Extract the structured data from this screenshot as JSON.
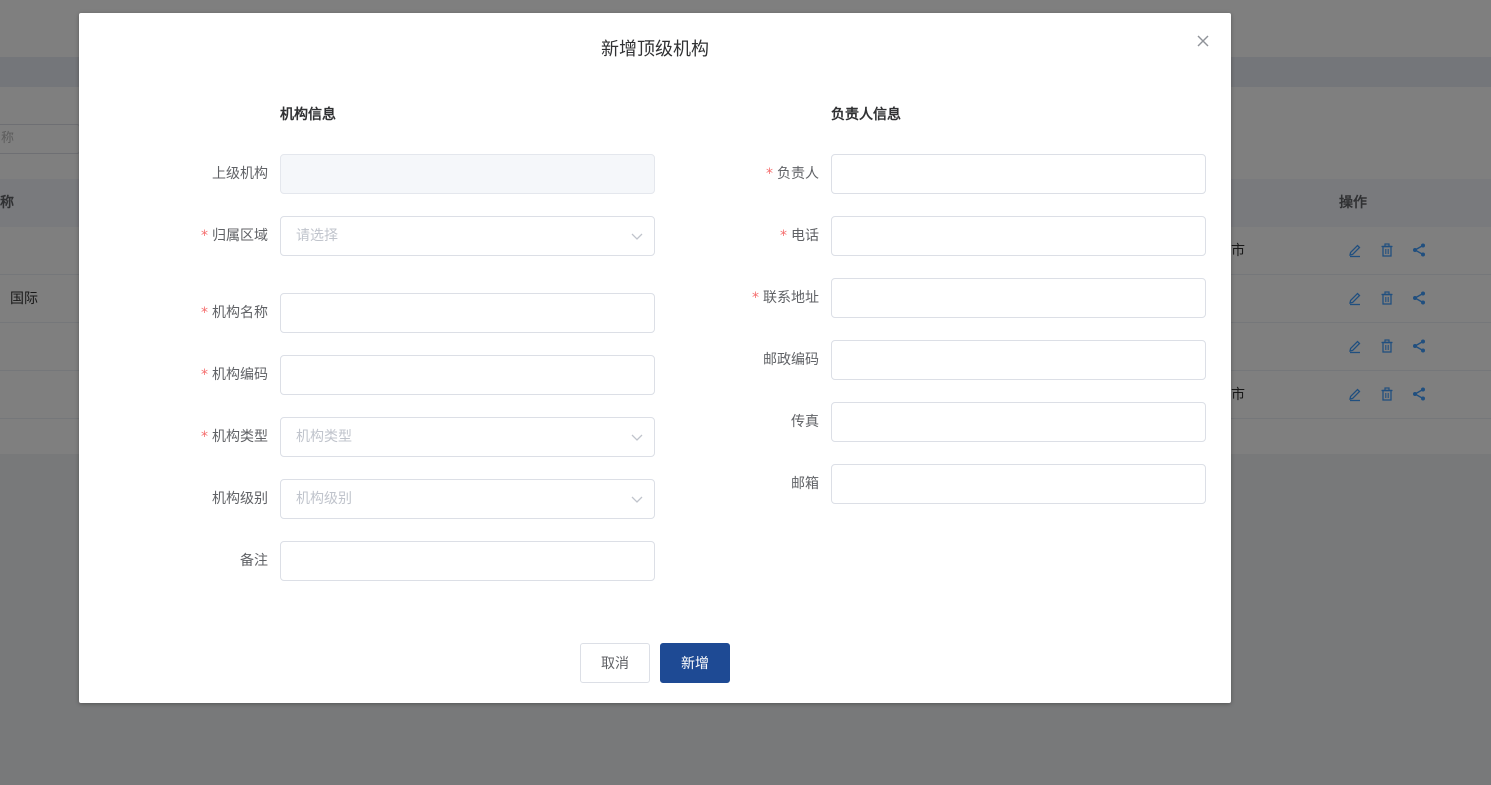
{
  "background": {
    "search_placeholder_fragment": "称",
    "table_header_name": "称",
    "table_header_actions": "操作",
    "rows": [
      {
        "name": "",
        "region": "市"
      },
      {
        "name": "国际",
        "region": ""
      },
      {
        "name": "",
        "region": ""
      },
      {
        "name": "",
        "region": "市"
      }
    ],
    "row_action_icons": [
      "edit-icon",
      "delete-icon",
      "share-icon"
    ],
    "action_icon_color": "#409eff"
  },
  "dialog": {
    "title": "新增顶级机构",
    "close_icon": "close-icon",
    "left_section_title": "机构信息",
    "right_section_title": "负责人信息",
    "left_fields": {
      "parent": {
        "label": "上级机构",
        "required": false,
        "value": ""
      },
      "region": {
        "label": "归属区域",
        "required": true,
        "placeholder": "请选择"
      },
      "org_name": {
        "label": "机构名称",
        "required": true,
        "value": ""
      },
      "org_code": {
        "label": "机构编码",
        "required": true,
        "value": ""
      },
      "org_type": {
        "label": "机构类型",
        "required": true,
        "placeholder": "机构类型"
      },
      "org_level": {
        "label": "机构级别",
        "required": false,
        "placeholder": "机构级别"
      },
      "remark": {
        "label": "备注",
        "required": false,
        "value": ""
      }
    },
    "right_fields": {
      "manager": {
        "label": "负责人",
        "required": true,
        "value": ""
      },
      "phone": {
        "label": "电话",
        "required": true,
        "value": ""
      },
      "address": {
        "label": "联系地址",
        "required": true,
        "value": ""
      },
      "postcode": {
        "label": "邮政编码",
        "required": false,
        "value": ""
      },
      "fax": {
        "label": "传真",
        "required": false,
        "value": ""
      },
      "email": {
        "label": "邮箱",
        "required": false,
        "value": ""
      }
    },
    "required_mark": "*",
    "cancel_label": "取消",
    "submit_label": "新增"
  },
  "colors": {
    "primary": "#1e4a94",
    "required": "#f56c6c"
  }
}
